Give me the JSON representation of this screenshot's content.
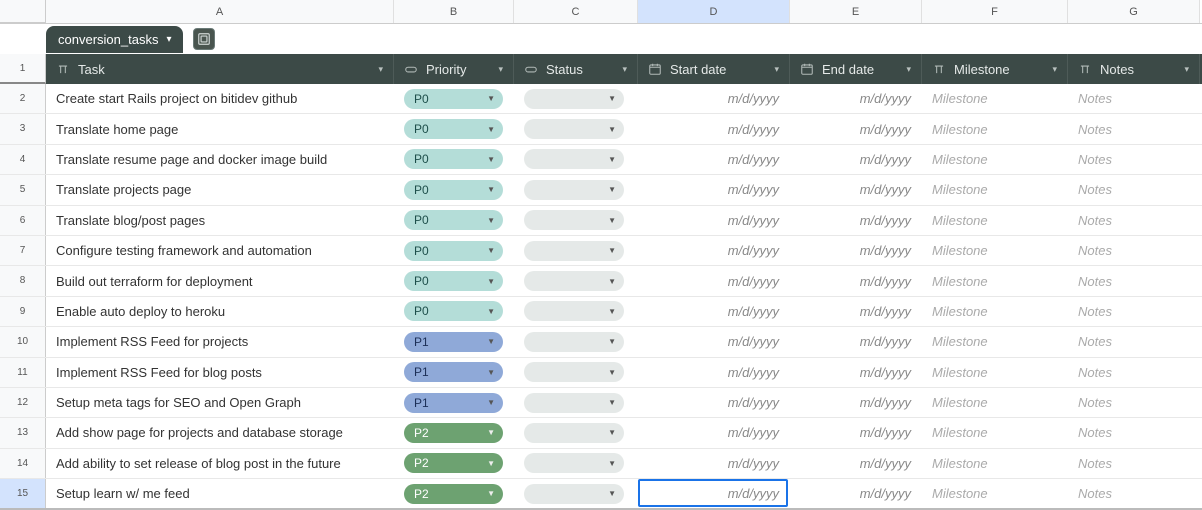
{
  "tab_name": "conversion_tasks",
  "columns": [
    "A",
    "B",
    "C",
    "D",
    "E",
    "F",
    "G"
  ],
  "selected_column": "D",
  "header": {
    "task": "Task",
    "priority": "Priority",
    "status": "Status",
    "start_date": "Start date",
    "end_date": "End date",
    "milestone": "Milestone",
    "notes": "Notes"
  },
  "placeholders": {
    "date": "m/d/yyyy",
    "milestone": "Milestone",
    "notes": "Notes"
  },
  "selected_row": 15,
  "rows": [
    {
      "n": 2,
      "task": "Create start Rails project on bitidev github",
      "priority": "P0"
    },
    {
      "n": 3,
      "task": "Translate home page",
      "priority": "P0"
    },
    {
      "n": 4,
      "task": "Translate resume page and docker image build",
      "priority": "P0"
    },
    {
      "n": 5,
      "task": "Translate projects page",
      "priority": "P0"
    },
    {
      "n": 6,
      "task": "Translate blog/post pages",
      "priority": "P0"
    },
    {
      "n": 7,
      "task": "Configure testing framework and automation",
      "priority": "P0"
    },
    {
      "n": 8,
      "task": "Build out terraform for deployment",
      "priority": "P0"
    },
    {
      "n": 9,
      "task": "Enable auto deploy to heroku",
      "priority": "P0"
    },
    {
      "n": 10,
      "task": "Implement RSS Feed for projects",
      "priority": "P1"
    },
    {
      "n": 11,
      "task": "Implement RSS Feed for blog posts",
      "priority": "P1"
    },
    {
      "n": 12,
      "task": "Setup meta tags for SEO and Open Graph",
      "priority": "P1"
    },
    {
      "n": 13,
      "task": "Add show page for projects and database storage",
      "priority": "P2"
    },
    {
      "n": 14,
      "task": "Add ability to set release of blog post in the future",
      "priority": "P2"
    },
    {
      "n": 15,
      "task": "Setup learn w/ me feed",
      "priority": "P2"
    }
  ],
  "chart_data": {
    "type": "table",
    "columns": [
      "Task",
      "Priority",
      "Status",
      "Start date",
      "End date",
      "Milestone",
      "Notes"
    ],
    "rows": [
      [
        "Create start Rails project on bitidev github",
        "P0",
        "",
        "",
        "",
        "",
        ""
      ],
      [
        "Translate home page",
        "P0",
        "",
        "",
        "",
        "",
        ""
      ],
      [
        "Translate resume page and docker image build",
        "P0",
        "",
        "",
        "",
        "",
        ""
      ],
      [
        "Translate projects page",
        "P0",
        "",
        "",
        "",
        "",
        ""
      ],
      [
        "Translate blog/post pages",
        "P0",
        "",
        "",
        "",
        "",
        ""
      ],
      [
        "Configure testing framework and automation",
        "P0",
        "",
        "",
        "",
        "",
        ""
      ],
      [
        "Build out terraform for deployment",
        "P0",
        "",
        "",
        "",
        "",
        ""
      ],
      [
        "Enable auto deploy to heroku",
        "P0",
        "",
        "",
        "",
        "",
        ""
      ],
      [
        "Implement RSS Feed for projects",
        "P1",
        "",
        "",
        "",
        "",
        ""
      ],
      [
        "Implement RSS Feed for blog posts",
        "P1",
        "",
        "",
        "",
        "",
        ""
      ],
      [
        "Setup meta tags for SEO and Open Graph",
        "P1",
        "",
        "",
        "",
        "",
        ""
      ],
      [
        "Add show page for projects and database storage",
        "P2",
        "",
        "",
        "",
        "",
        ""
      ],
      [
        "Add ability to set release of blog post in the future",
        "P2",
        "",
        "",
        "",
        "",
        ""
      ],
      [
        "Setup learn w/ me feed",
        "P2",
        "",
        "",
        "",
        "",
        ""
      ]
    ]
  }
}
